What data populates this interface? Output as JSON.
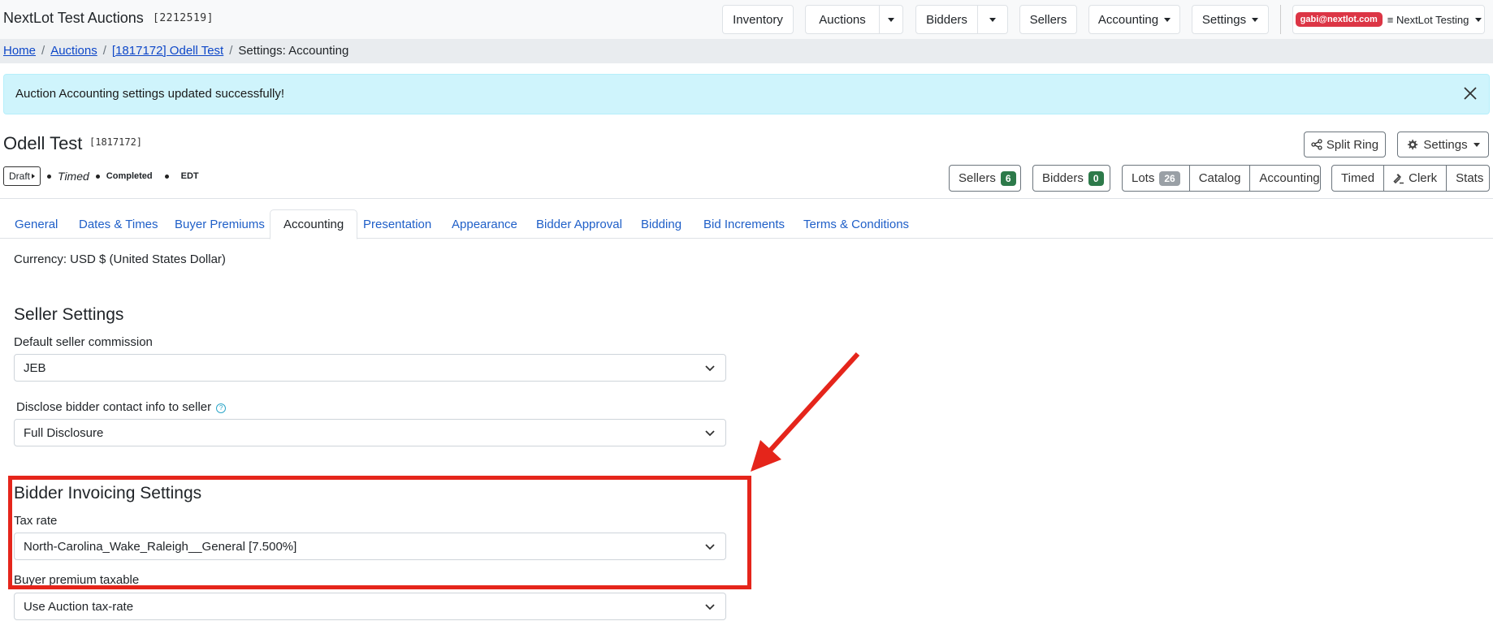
{
  "navbar": {
    "brand": "NextLot Test Auctions",
    "brand_id": "[2212519]",
    "inventory": "Inventory",
    "auctions": "Auctions",
    "bidders": "Bidders",
    "sellers": "Sellers",
    "accounting": "Accounting",
    "settings": "Settings",
    "user_email": "gabi@nextlot.com",
    "user_account": "≡ NextLot Testing"
  },
  "breadcrumb": {
    "home": "Home",
    "auctions": "Auctions",
    "auction": "[1817172] Odell Test",
    "current": "Settings: Accounting"
  },
  "alert": {
    "message": "Auction Accounting settings updated successfully!"
  },
  "auction": {
    "title": "Odell Test",
    "id": "[1817172]",
    "split_ring": "Split Ring",
    "settings": "Settings",
    "status": {
      "draft": "Draft",
      "timed": "Timed",
      "completed": "Completed",
      "timezone": "EDT"
    },
    "actions": {
      "sellers": "Sellers",
      "sellers_count": "6",
      "bidders": "Bidders",
      "bidders_count": "0",
      "lots": "Lots",
      "lots_count": "26",
      "catalog": "Catalog",
      "accounting": "Accounting",
      "timed": "Timed",
      "clerk": "Clerk",
      "stats": "Stats"
    }
  },
  "tabs": [
    "General",
    "Dates & Times",
    "Buyer Premiums",
    "Accounting",
    "Presentation",
    "Appearance",
    "Bidder Approval",
    "Bidding",
    "Bid Increments",
    "Terms & Conditions"
  ],
  "form": {
    "currency": "Currency: USD $ (United States Dollar)",
    "seller_heading": "Seller Settings",
    "commission_label": "Default seller commission",
    "commission_value": "JEB",
    "disclose_label": "Disclose bidder contact info to seller",
    "disclose_value": "Full Disclosure",
    "invoicing_heading": "Bidder Invoicing Settings",
    "tax_label": "Tax rate",
    "tax_value": "North-Carolina_Wake_Raleigh__General [7.500%]",
    "bp_label": "Buyer premium taxable",
    "bp_value": "Use Auction tax-rate"
  },
  "colors": {
    "annotation": "#e5251b",
    "link": "#1f5fc8",
    "alert_bg": "#cff4fc",
    "badge_green": "#2d7a4a",
    "badge_red": "#dc3545"
  }
}
